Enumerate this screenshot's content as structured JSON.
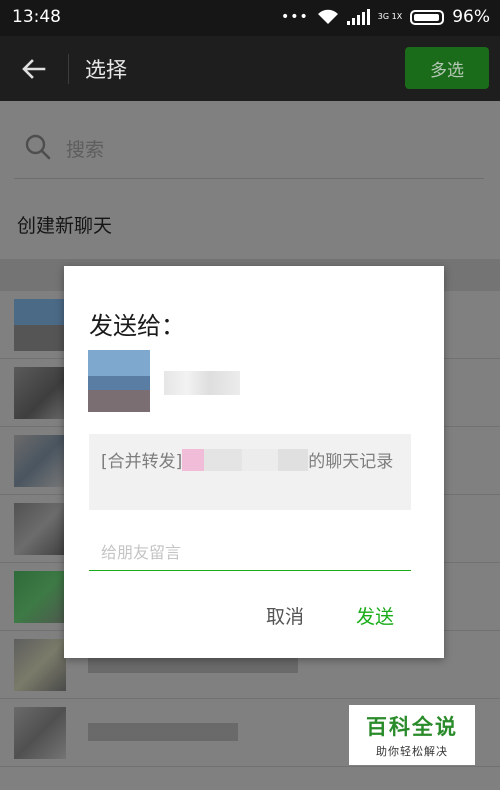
{
  "status_bar": {
    "time": "13:48",
    "dots": "•••",
    "network": "3G 1X",
    "battery": "96%"
  },
  "title_bar": {
    "back_icon": "back-arrow-icon",
    "title": "选择",
    "multi_select_label": "多选"
  },
  "list": {
    "search_placeholder": "搜索",
    "search_icon": "search-icon",
    "new_chat_label": "创建新聊天"
  },
  "dialog": {
    "title": "发送给：",
    "message_prefix": "[合并转发]",
    "message_suffix": "的聊天记录",
    "input_placeholder": "给朋友留言",
    "cancel_label": "取消",
    "send_label": "发送"
  },
  "watermark": {
    "main": "百科全说",
    "sub": "助你轻松解决"
  },
  "colors": {
    "accent_green": "#1aad19",
    "multi_button_bg": "#1a6b1a",
    "status_bar_bg": "#161616",
    "title_bar_bg": "#1e1e1e"
  }
}
